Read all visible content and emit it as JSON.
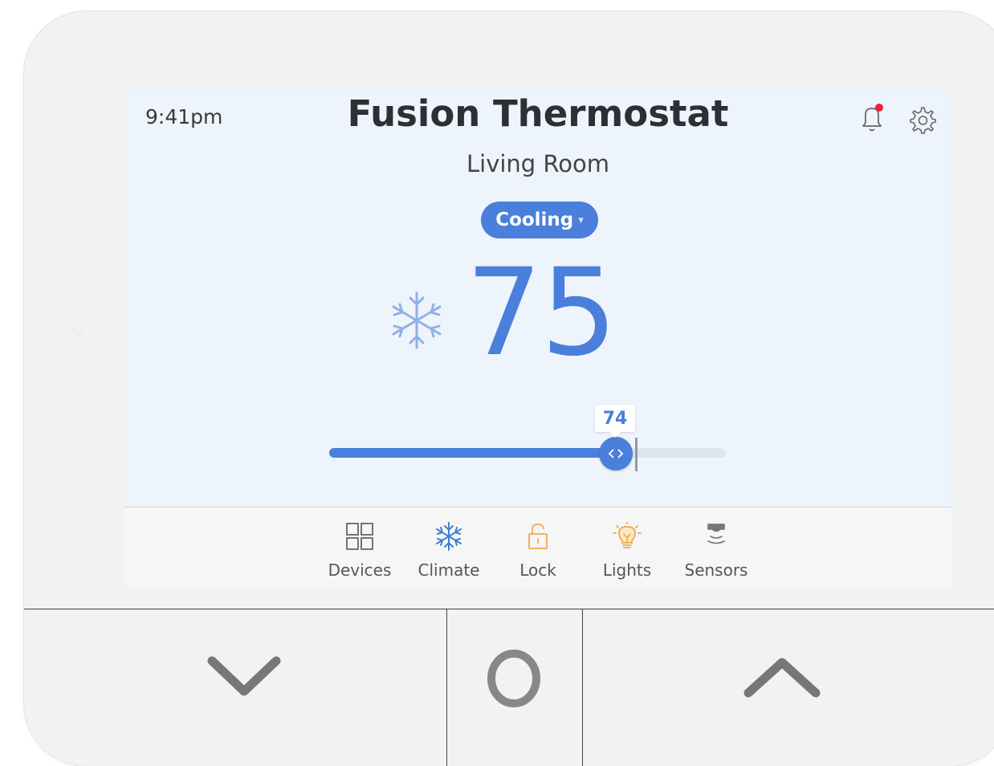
{
  "header": {
    "time": "9:41pm",
    "title": "Fusion Thermostat",
    "room": "Living Room",
    "notification_icon": "bell-icon",
    "settings_icon": "gear-icon"
  },
  "mode": {
    "label": "Cooling",
    "caret": "▾",
    "icon": "snowflake-icon"
  },
  "temperature": {
    "current": "75",
    "setpoint": "74",
    "slider_fraction": 0.72
  },
  "tabs": [
    {
      "label": "Devices",
      "icon": "grid-icon"
    },
    {
      "label": "Climate",
      "icon": "snowflake-icon"
    },
    {
      "label": "Lock",
      "icon": "lock-icon"
    },
    {
      "label": "Lights",
      "icon": "bulb-icon"
    },
    {
      "label": "Sensors",
      "icon": "sensor-icon"
    }
  ],
  "hardware_buttons": {
    "down": "chevron-down-icon",
    "home": "circle-icon",
    "up": "chevron-up-icon"
  },
  "colors": {
    "accent": "#4a7fdb",
    "notification_dot": "#e8243c",
    "lock": "#f0a94a",
    "lights": "#f0a94a"
  }
}
